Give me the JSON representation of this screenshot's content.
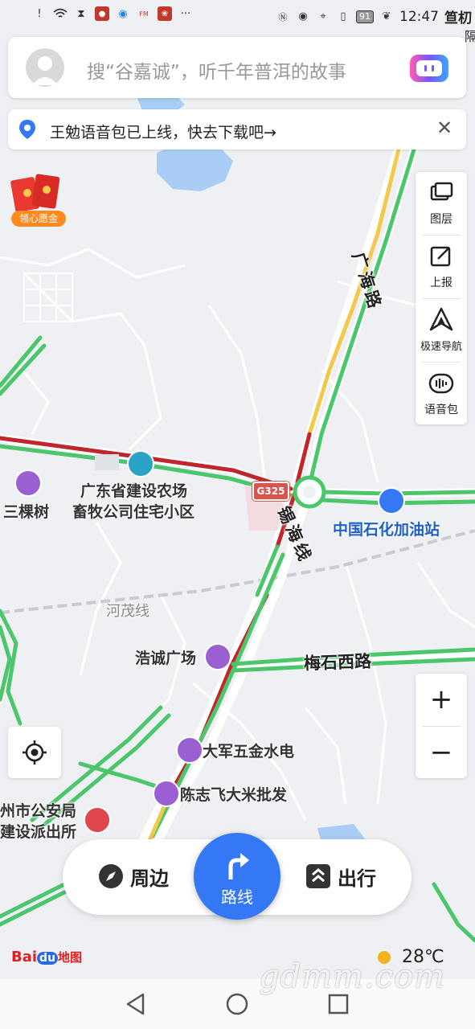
{
  "status_bar": {
    "time": "12:47",
    "battery": "91",
    "icons": [
      "alert-icon",
      "wifi-icon",
      "hourglass-icon",
      "mic-app-icon",
      "browser-app-icon",
      "fm-app-icon",
      "lotus-app-icon",
      "more-icon",
      "nfc-icon",
      "eye-icon",
      "location-icon",
      "vibrate-icon",
      "leaf-icon"
    ],
    "more_dots": "···",
    "edge_text": "笪朷",
    "edge_text2": "隔"
  },
  "search": {
    "placeholder": "搜“谷嘉诚”，听千年普洱的故事"
  },
  "banner": {
    "text": "王勉语音包已上线，快去下载吧→",
    "close": "✕"
  },
  "red_packet": {
    "label": "领心愿金"
  },
  "tools": [
    {
      "label": "图层",
      "icon": "layers-icon"
    },
    {
      "label": "上报",
      "icon": "report-icon"
    },
    {
      "label": "极速导航",
      "icon": "navigation-icon"
    },
    {
      "label": "语音包",
      "icon": "voice-pack-icon"
    }
  ],
  "zoom": {
    "in": "+",
    "out": "−"
  },
  "map": {
    "roads": {
      "guanghai": "广海路",
      "xihai": "锡海线",
      "hemao": "河茂线",
      "meishi": "梅石西路",
      "shield": "G325"
    },
    "pois": {
      "farm_line1": "广东省建设农场",
      "farm_line2": "畜牧公司住宅小区",
      "sankeshu": "三棵树",
      "gas": "中国石化加油站",
      "haocheng": "浩诚广场",
      "dajun": "大军五金水电",
      "chenzhifei": "陈志飞大米批发",
      "police_line1": "州市公安局",
      "police_line2": "建设派出所"
    }
  },
  "bottom_bar": {
    "nearby": "周边",
    "route": "路线",
    "travel": "出行"
  },
  "logo": {
    "bai": "Bai",
    "du": "du",
    "map": "地图"
  },
  "weather": {
    "temp": "28℃"
  },
  "watermark": "gdmm.com",
  "colors": {
    "accent": "#3478f6",
    "road_green": "#4cc66b",
    "road_red": "#c0262c",
    "road_yellow": "#f2c94c",
    "poi_purple": "#9a5fd0",
    "water": "#a9cdf5"
  }
}
